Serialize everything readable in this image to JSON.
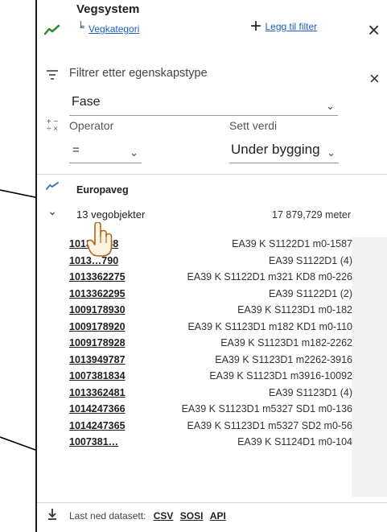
{
  "layer": {
    "title": "Vegsystem",
    "category_link": "Vegkategori",
    "add_filter": "Legg til filter"
  },
  "filter": {
    "title": "Filtrer etter egenskapstype",
    "property_value": "Fase",
    "operator_label": "Operator",
    "operator_value": "=",
    "setvalue_label": "Sett verdi",
    "set_value": "Under bygging"
  },
  "result": {
    "road_type": "Europaveg",
    "count": "13 vegobjekter",
    "length": "17 879,729 meter"
  },
  "objects": [
    {
      "id": "1013…388",
      "desc": "EA39 K S1122D1 m0-1587"
    },
    {
      "id": "1013…790",
      "desc": "EA39 S1122D1 (4)"
    },
    {
      "id": "1013362275",
      "desc": "EA39 K S1122D1 m321 KD8 m0-226"
    },
    {
      "id": "1013362295",
      "desc": "EA39 S1122D1 (2)"
    },
    {
      "id": "1009178930",
      "desc": "EA39 K S1123D1 m0-182"
    },
    {
      "id": "1009178920",
      "desc": "EA39 K S1123D1 m182 KD1 m0-110"
    },
    {
      "id": "1009178928",
      "desc": "EA39 K S1123D1 m182-2262"
    },
    {
      "id": "1013949787",
      "desc": "EA39 K S1123D1 m2262-3916"
    },
    {
      "id": "1007381834",
      "desc": "EA39 K S1123D1 m3916-10092"
    },
    {
      "id": "1013362481",
      "desc": "EA39 S1123D1 (4)"
    },
    {
      "id": "1014247366",
      "desc": "EA39 K S1123D1 m5327 SD1 m0-136"
    },
    {
      "id": "1014247365",
      "desc": "EA39 K S1123D1 m5327 SD2 m0-56"
    },
    {
      "id": "1007381…",
      "desc": "EA39 K S1124D1 m0-104"
    }
  ],
  "footer": {
    "label": "Last ned datasett:",
    "csv": "CSV",
    "sosi": "SOSI",
    "api": "API"
  },
  "icons": {
    "layer": "trend-line-icon",
    "category": "road-category-icon",
    "add": "plus-icon",
    "close": "close-icon",
    "filter": "filter-lines-icon",
    "operator": "math-operators-icon",
    "result": "trend-line-icon",
    "expand": "chevron-down-icon",
    "cursor": "hand-pointer-icon",
    "download": "download-icon"
  },
  "colors": {
    "accent_green": "#2e8b2e",
    "link_blue": "#1f5fbf"
  }
}
